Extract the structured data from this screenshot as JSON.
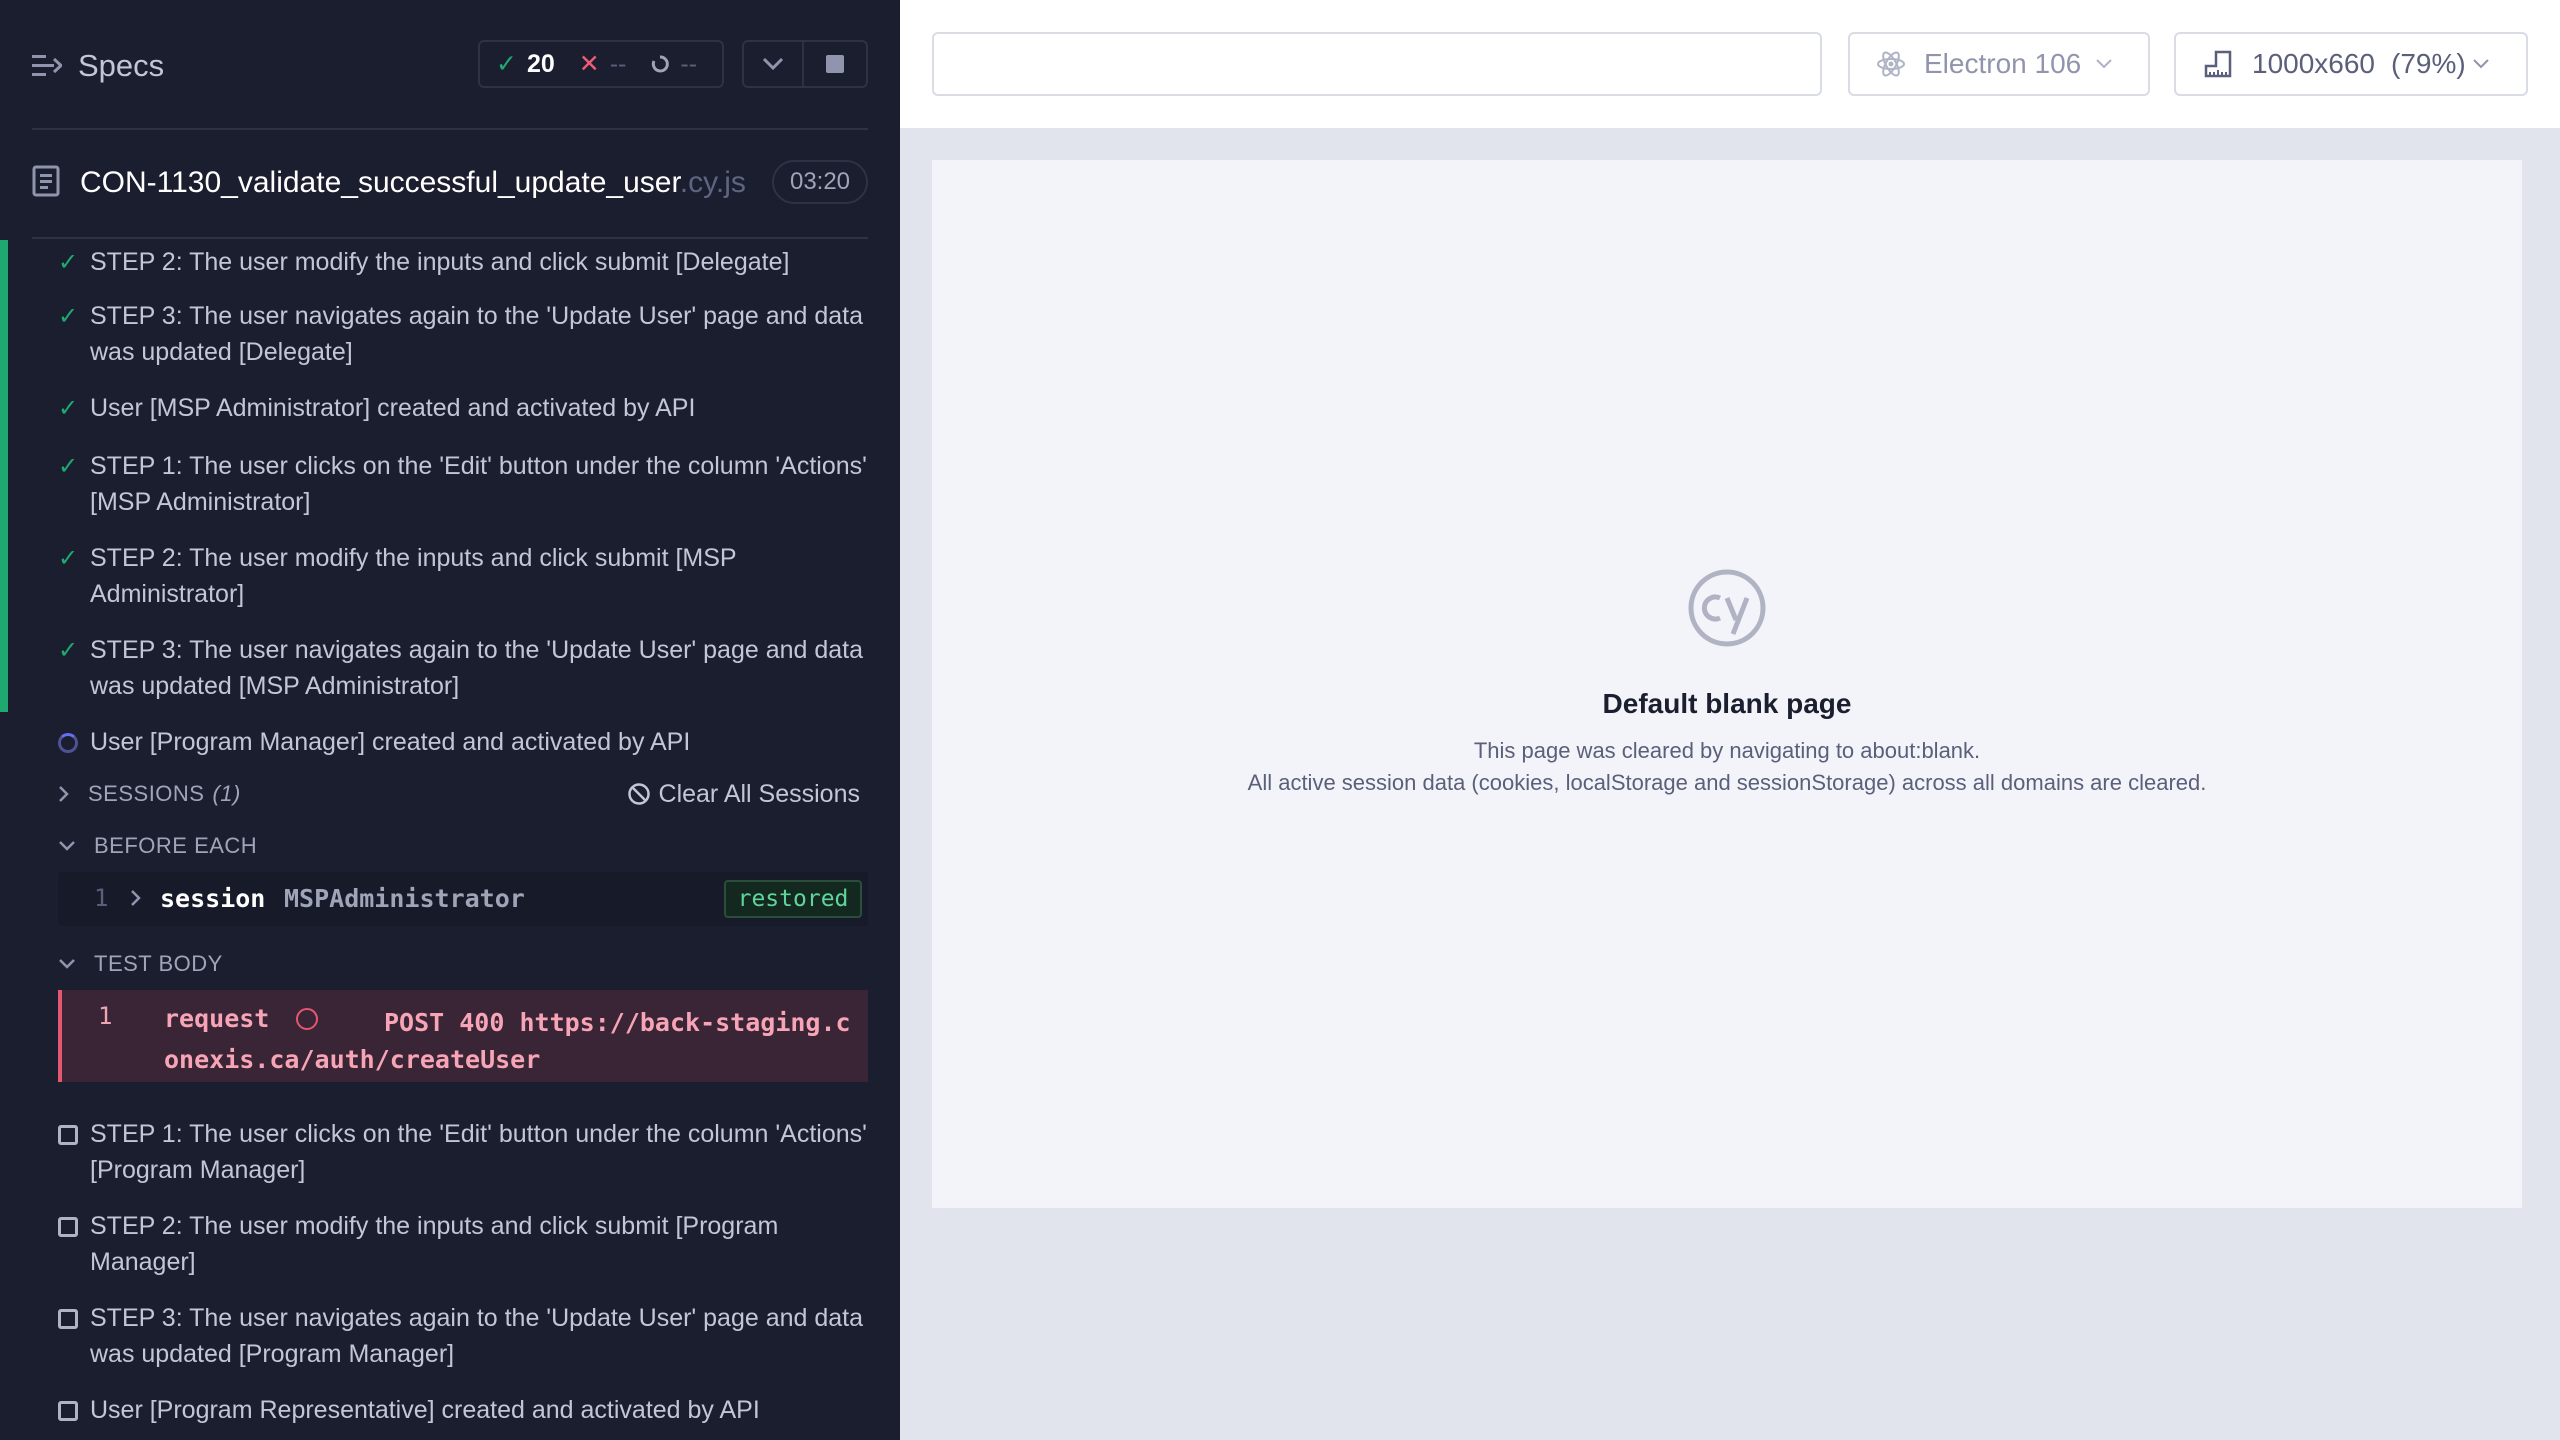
{
  "reporter": {
    "specs_label": "Specs",
    "stats": {
      "passed": "20",
      "failed": "--",
      "pending": "--"
    },
    "spec": {
      "name": "CON-1130_validate_successful_update_user",
      "ext": ".cy.js",
      "duration": "03:20"
    },
    "tests_top": [
      {
        "title": "STEP 2: The user modify the inputs and click submit [Delegate]",
        "status": "passed"
      },
      {
        "title": "STEP 3: The user navigates again to the 'Update User' page and data was updated [Delegate]",
        "status": "passed"
      },
      {
        "title": "User [MSP Administrator] created and activated by API",
        "status": "passed"
      },
      {
        "title": "STEP 1: The user clicks on the 'Edit' button under the column 'Actions' [MSP Administrator]",
        "status": "passed"
      },
      {
        "title": "STEP 2: The user modify the inputs and click submit [MSP Administrator]",
        "status": "passed"
      },
      {
        "title": "STEP 3: The user navigates again to the 'Update User' page and data was updated [MSP Administrator]",
        "status": "passed"
      },
      {
        "title": "User [Program Manager] created and activated by API",
        "status": "running"
      }
    ],
    "sessions": {
      "label": "SESSIONS",
      "count": "(1)",
      "clear_label": "Clear All Sessions"
    },
    "before_each": {
      "label": "BEFORE EACH",
      "command": {
        "number": "1",
        "name": "session",
        "message": "MSPAdministrator",
        "badge": "restored"
      }
    },
    "test_body": {
      "label": "TEST BODY",
      "command": {
        "number": "1",
        "name": "request",
        "message": "POST 400 https://back-staging.conexis.ca/auth/createUser"
      }
    },
    "tests_bottom": [
      {
        "title": "STEP 1: The user clicks on the 'Edit' button under the column 'Actions' [Program Manager]",
        "status": "pending"
      },
      {
        "title": "STEP 2: The user modify the inputs and click submit [Program Manager]",
        "status": "pending"
      },
      {
        "title": "STEP 3: The user navigates again to the 'Update User' page and data was updated [Program Manager]",
        "status": "pending"
      },
      {
        "title": "User [Program Representative] created and activated by API",
        "status": "pending"
      }
    ]
  },
  "aut": {
    "url_value": "",
    "browser": "Electron 106",
    "viewport": "1000x660",
    "zoom": "(79%)",
    "blank_page": {
      "title": "Default blank page",
      "line1": "This page was cleared by navigating to about:blank.",
      "line2": "All active session data (cookies, localStorage and sessionStorage) across all domains are cleared."
    }
  },
  "colors": {
    "passed": "#1fa971",
    "failed": "#f05b78",
    "running": "#6470f3",
    "sidebar_bg": "#1b1e2e"
  }
}
